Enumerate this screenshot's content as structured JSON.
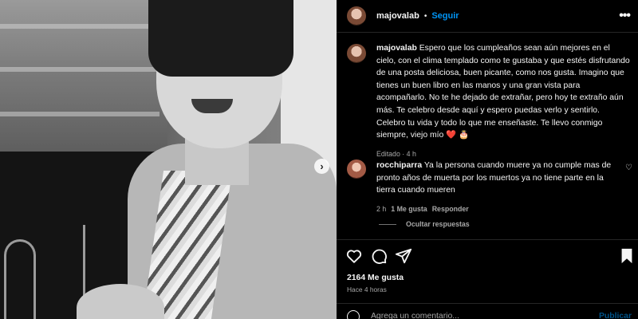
{
  "post": {
    "username": "majovalab",
    "follow_label": "Seguir",
    "dot": "•",
    "more_label": "•••",
    "caption": "Espero que los cumpleaños sean aún mejores en el cielo, con el clima templado como te gustaba y que estés disfrutando de una posta deliciosa, buen picante, como nos gusta. Imagino que tienes un buen libro en las manos y una gran vista para acompañarlo. No te he dejado de extrañar, pero hoy te extraño aún más. Te celebro desde aquí y espero puedas verlo y sentirlo. Celebro tu vida y todo lo que me enseñaste. Te llevo conmigo siempre, viejo mío",
    "caption_emoji": "❤️ 🎂",
    "caption_meta": "Editado · 4 h"
  },
  "comment": {
    "username": "rocchiparra",
    "text": "Ya la persona cuando muere ya no cumple mas de pronto años de muerta por los muertos ya no tiene parte en la tierra cuando mueren",
    "time": "2 h",
    "likes": "1 Me gusta",
    "reply_label": "Responder",
    "like_icon": "♡"
  },
  "replies_label": "Ocultar respuestas",
  "likes_label": "2164 Me gusta",
  "time_label": "Hace 4 horas",
  "add_comment": {
    "placeholder": "Agrega un comentario...",
    "publish_label": "Publicar"
  },
  "carousel_next": "›",
  "icons": [
    "heart-icon",
    "comment-icon",
    "share-icon",
    "bookmark-icon",
    "more-icon",
    "emoji-icon",
    "chevron-right-icon"
  ],
  "colors": {
    "accent": "#0095f6",
    "background": "#000000",
    "muted": "#a8a8a8",
    "heart": "#ff3040"
  }
}
